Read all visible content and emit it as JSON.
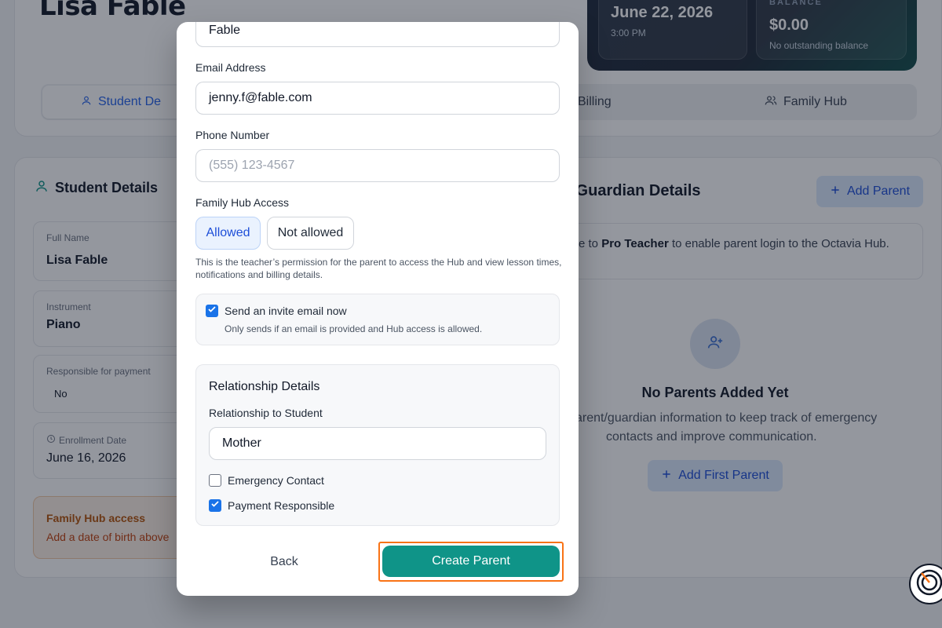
{
  "background": {
    "student_name": "Lisa Fable",
    "next_lesson": {
      "date": "June 22, 2026",
      "time": "3:00 PM"
    },
    "balance": {
      "label": "BALANCE",
      "amount": "$0.00",
      "note": "No outstanding balance"
    },
    "tabs": [
      {
        "label": "Student De",
        "icon": "user-icon",
        "active": true
      },
      {
        "label": "Billing",
        "icon": "",
        "active": false
      },
      {
        "label": "Family Hub",
        "icon": "users-icon",
        "active": false
      }
    ],
    "student_details": {
      "title": "Student Details",
      "fields": [
        {
          "label": "Full Name",
          "value": "Lisa Fable"
        },
        {
          "label": "Instrument",
          "value": "Piano"
        },
        {
          "label": "Responsible for payment",
          "value": "No"
        },
        {
          "label": "Enrollment Date",
          "value": "June 16, 2026"
        }
      ],
      "family_hub_notice": {
        "title": "Family Hub access",
        "text": "Add a date of birth above"
      }
    },
    "parent_guardian": {
      "title": "/Guardian Details",
      "add_button": "Add Parent",
      "upgrade_prefix": "e to ",
      "upgrade_bold": "Pro Teacher",
      "upgrade_suffix": " to enable parent login to the Octavia Hub.",
      "upgrade_link": "e",
      "empty_title": "No Parents Added Yet",
      "empty_line1": "arent/guardian information to keep track of emergency",
      "empty_line2": "contacts and improve communication.",
      "add_first_button": "Add First Parent"
    }
  },
  "modal": {
    "last_name_value": "Fable",
    "email": {
      "label": "Email Address",
      "value": "jenny.f@fable.com"
    },
    "phone": {
      "label": "Phone Number",
      "placeholder": "(555) 123-4567"
    },
    "hub_access": {
      "label": "Family Hub Access",
      "options": [
        "Allowed",
        "Not allowed"
      ],
      "selected": "Allowed",
      "help": "This is the teacher’s permission for the parent to access the Hub and view lesson times, notifications and billing details."
    },
    "invite": {
      "label": "Send an invite email now",
      "sub": "Only sends if an email is provided and Hub access is allowed.",
      "checked": true
    },
    "relationship": {
      "title": "Relationship Details",
      "label": "Relationship to Student",
      "value": "Mother",
      "emergency_contact": {
        "label": "Emergency Contact",
        "checked": false
      },
      "payment_responsible": {
        "label": "Payment Responsible",
        "checked": true
      }
    },
    "back_label": "Back",
    "create_label": "Create Parent"
  },
  "colors": {
    "primary_teal": "#0f9488",
    "accent_blue": "#1d4ed8",
    "highlight_orange": "#f97316",
    "warning_orange": "#c2410c"
  }
}
